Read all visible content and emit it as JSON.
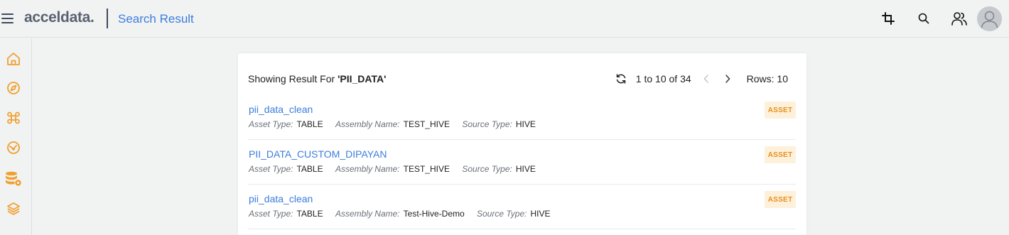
{
  "header": {
    "logo": "acceldata.",
    "page_title": "Search Result",
    "icons": [
      "hamburger-menu-icon",
      "crop-icon",
      "search-icon",
      "users-icon",
      "user-avatar-icon"
    ]
  },
  "sidebar": {
    "items": [
      {
        "name": "home-icon"
      },
      {
        "name": "compass-icon"
      },
      {
        "name": "command-icon"
      },
      {
        "name": "dashboard-gauge-icon"
      },
      {
        "name": "database-settings-icon"
      },
      {
        "name": "layers-icon"
      }
    ]
  },
  "results": {
    "prefix": "Showing Result For ",
    "query": "'PII_DATA'",
    "pagination": {
      "range": "1 to 10 of 34",
      "rows_label": "Rows: 10"
    },
    "labels": {
      "asset_type": "Asset Type:",
      "assembly_name": "Assembly Name:",
      "source_type": "Source Type:"
    },
    "items": [
      {
        "title": "pii_data_clean",
        "asset_type": "TABLE",
        "assembly_name": "TEST_HIVE",
        "source_type": "HIVE",
        "badge": "ASSET"
      },
      {
        "title": "PII_DATA_CUSTOM_DIPAYAN",
        "asset_type": "TABLE",
        "assembly_name": "TEST_HIVE",
        "source_type": "HIVE",
        "badge": "ASSET"
      },
      {
        "title": "pii_data_clean",
        "asset_type": "TABLE",
        "assembly_name": "Test-Hive-Demo",
        "source_type": "HIVE",
        "badge": "ASSET"
      }
    ]
  },
  "colors": {
    "accent": "#3b7ddd",
    "sidebar_icon": "#f0a030",
    "badge_bg": "#fdf1dc",
    "badge_text": "#e8901c",
    "background": "#f1f2f2"
  }
}
